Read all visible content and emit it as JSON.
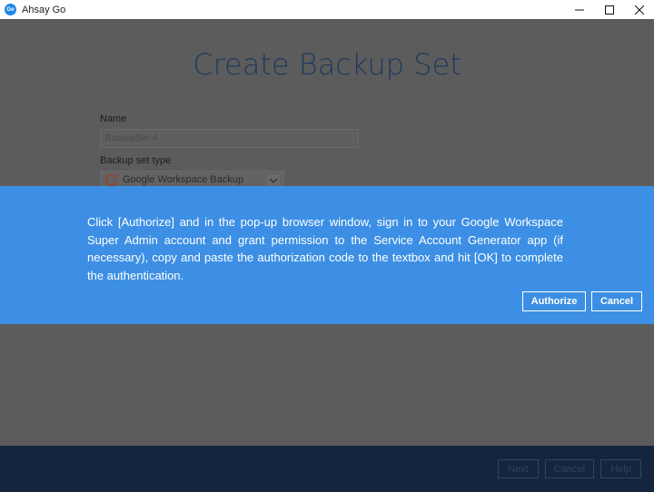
{
  "window": {
    "logo_text": "Go",
    "title": "Ahsay Go"
  },
  "page": {
    "title": "Create Backup Set",
    "name_label": "Name",
    "name_value": "BackupSet-4",
    "type_label": "Backup set type",
    "type_value": "Google Workspace Backup"
  },
  "modal": {
    "message": "Click [Authorize] and in the pop-up browser window, sign in to your Google Workspace Super Admin account and grant permission to the Service Account Generator app (if necessary), copy and paste the authorization code to the textbox and hit [OK] to complete the authentication.",
    "authorize_label": "Authorize",
    "cancel_label": "Cancel",
    "color": "#3c8fe4"
  },
  "footer": {
    "next_label": "Next",
    "cancel_label": "Cancel",
    "help_label": "Help",
    "color": "#14263e"
  },
  "icons": {
    "app": "ahsay-go-logo-icon",
    "minimize": "minimize-icon",
    "maximize": "maximize-icon",
    "close": "close-icon",
    "type": "google-icon",
    "select": "chevron-down-icon"
  }
}
